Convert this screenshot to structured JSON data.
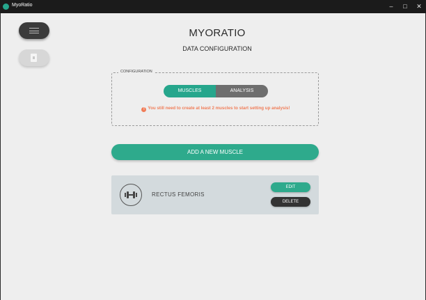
{
  "window": {
    "title": "MyoRatio",
    "minimize": "–",
    "maximize": "□",
    "close": "✕"
  },
  "sidebar": {
    "menu_icon": "hamburger-menu-icon",
    "file_icon": "file-icon"
  },
  "header": {
    "app_title": "MYORATIO",
    "page_subtitle": "DATA CONFIGURATION"
  },
  "configuration": {
    "legend": "CONFIGURATION",
    "tabs": [
      {
        "label": "MUSCLES",
        "active": true
      },
      {
        "label": "ANALYSIS",
        "active": false
      }
    ],
    "warning_icon": "!",
    "warning": "You still need to create at least 2 muscles to start setting up analysis!"
  },
  "actions": {
    "add_muscle": "ADD A NEW MUSCLE"
  },
  "muscles": [
    {
      "icon": "dumbbell-icon",
      "name": "RECTUS FEMORIS",
      "edit_label": "EDIT",
      "delete_label": "DELETE"
    }
  ],
  "colors": {
    "accent": "#2eaa8c",
    "warning": "#f07c57",
    "dark": "#333333",
    "card": "#d3dadd"
  }
}
